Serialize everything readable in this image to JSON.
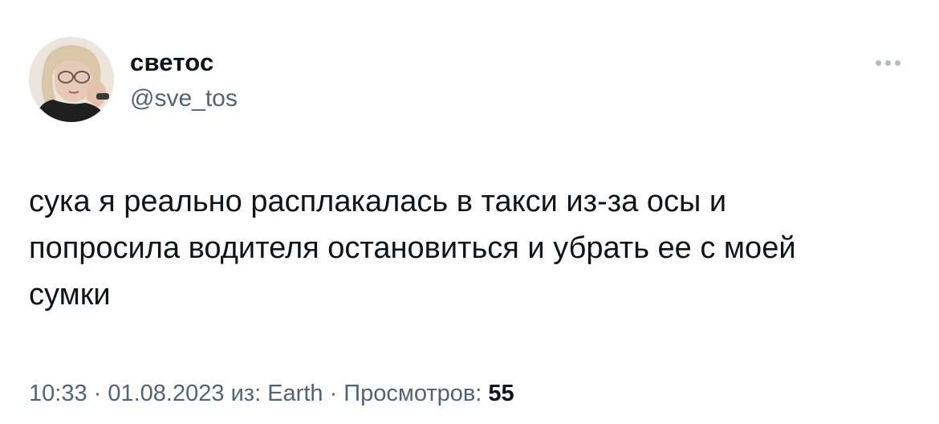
{
  "author": {
    "display_name": "светос",
    "handle": "@sve_tos",
    "avatar_icon": "profile-photo"
  },
  "menu": {
    "more_icon": "more-horizontal-icon"
  },
  "tweet": {
    "text": "сука я реально расплакалась в такси из-за осы и\nпопросила водителя остановиться и убрать ее с моей\nсумки"
  },
  "meta": {
    "time": "10:33",
    "separator1": " · ",
    "date": "01.08.2023",
    "source_prefix": " из: ",
    "source": "Earth",
    "separator2": " · ",
    "views_label": "Просмотров: ",
    "views_count": "55"
  },
  "colors": {
    "text_primary": "#0f1419",
    "text_secondary": "#536471",
    "background": "#ffffff"
  }
}
